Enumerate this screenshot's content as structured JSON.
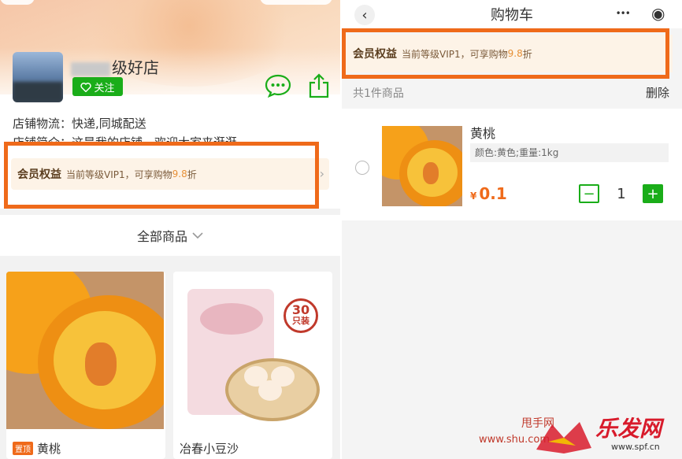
{
  "left": {
    "shop": {
      "name": "级好店",
      "follow_label": "关注",
      "logistics": "店铺物流：快递,同城配送",
      "intro": "店铺简介：这是我的店铺，欢迎大家来逛逛"
    },
    "vip": {
      "title": "会员权益",
      "desc": "当前等级VIP1，可享购物",
      "rate": "9.8",
      "suffix": "折",
      "arrow": "›"
    },
    "tab": {
      "label": "全部商品",
      "chevron": "⌵"
    },
    "products": [
      {
        "tag": "置顶",
        "name": "黄桃"
      },
      {
        "name": "冶春小豆沙",
        "badge_number": "30",
        "badge_unit": "只装"
      }
    ]
  },
  "right": {
    "nav": {
      "back": "‹",
      "title": "购物车",
      "more": "•••",
      "target": "◉"
    },
    "vip": {
      "title": "会员权益",
      "desc": "当前等级VIP1，可享购物",
      "rate": "9.8",
      "suffix": "折"
    },
    "count": "共1件商品",
    "delete_label": "删除",
    "item": {
      "name": "黄桃",
      "spec": "颜色:黄色;重量:1kg",
      "currency": "¥",
      "price": "0.1",
      "qty": "1",
      "minus": "−",
      "plus": "+"
    }
  },
  "watermark": {
    "a": "甩手网",
    "b": "www.shu",
    "c": "乐发网",
    "d": "www.spf.cn",
    "e": ".com"
  },
  "colors": {
    "accent_green": "#1aad19",
    "highlight_orange": "#ef6a1a",
    "vip_bg": "#fdf3e7"
  }
}
